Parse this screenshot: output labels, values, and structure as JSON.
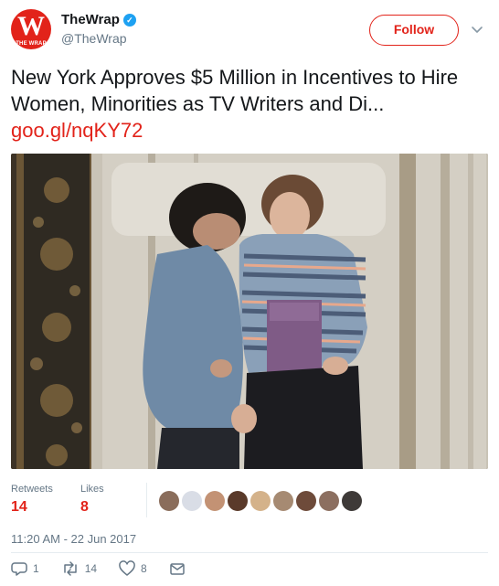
{
  "account": {
    "display_name": "TheWrap",
    "handle": "@TheWrap",
    "avatar_letter": "W",
    "avatar_subtext": "THE WRAP"
  },
  "follow_label": "Follow",
  "tweet": {
    "text": "New York Approves $5 Million in Incentives to Hire Women, Minorities as TV Writers and Di...",
    "link": "goo.gl/nqKY72"
  },
  "stats": {
    "retweets_label": "Retweets",
    "retweets_count": "14",
    "likes_label": "Likes",
    "likes_count": "8"
  },
  "timestamp": "11:20 AM - 22 Jun 2017",
  "actions": {
    "reply_count": "1",
    "retweet_count": "14",
    "like_count": "8"
  },
  "colors": {
    "brand": "#e2231a",
    "muted": "#657786"
  }
}
